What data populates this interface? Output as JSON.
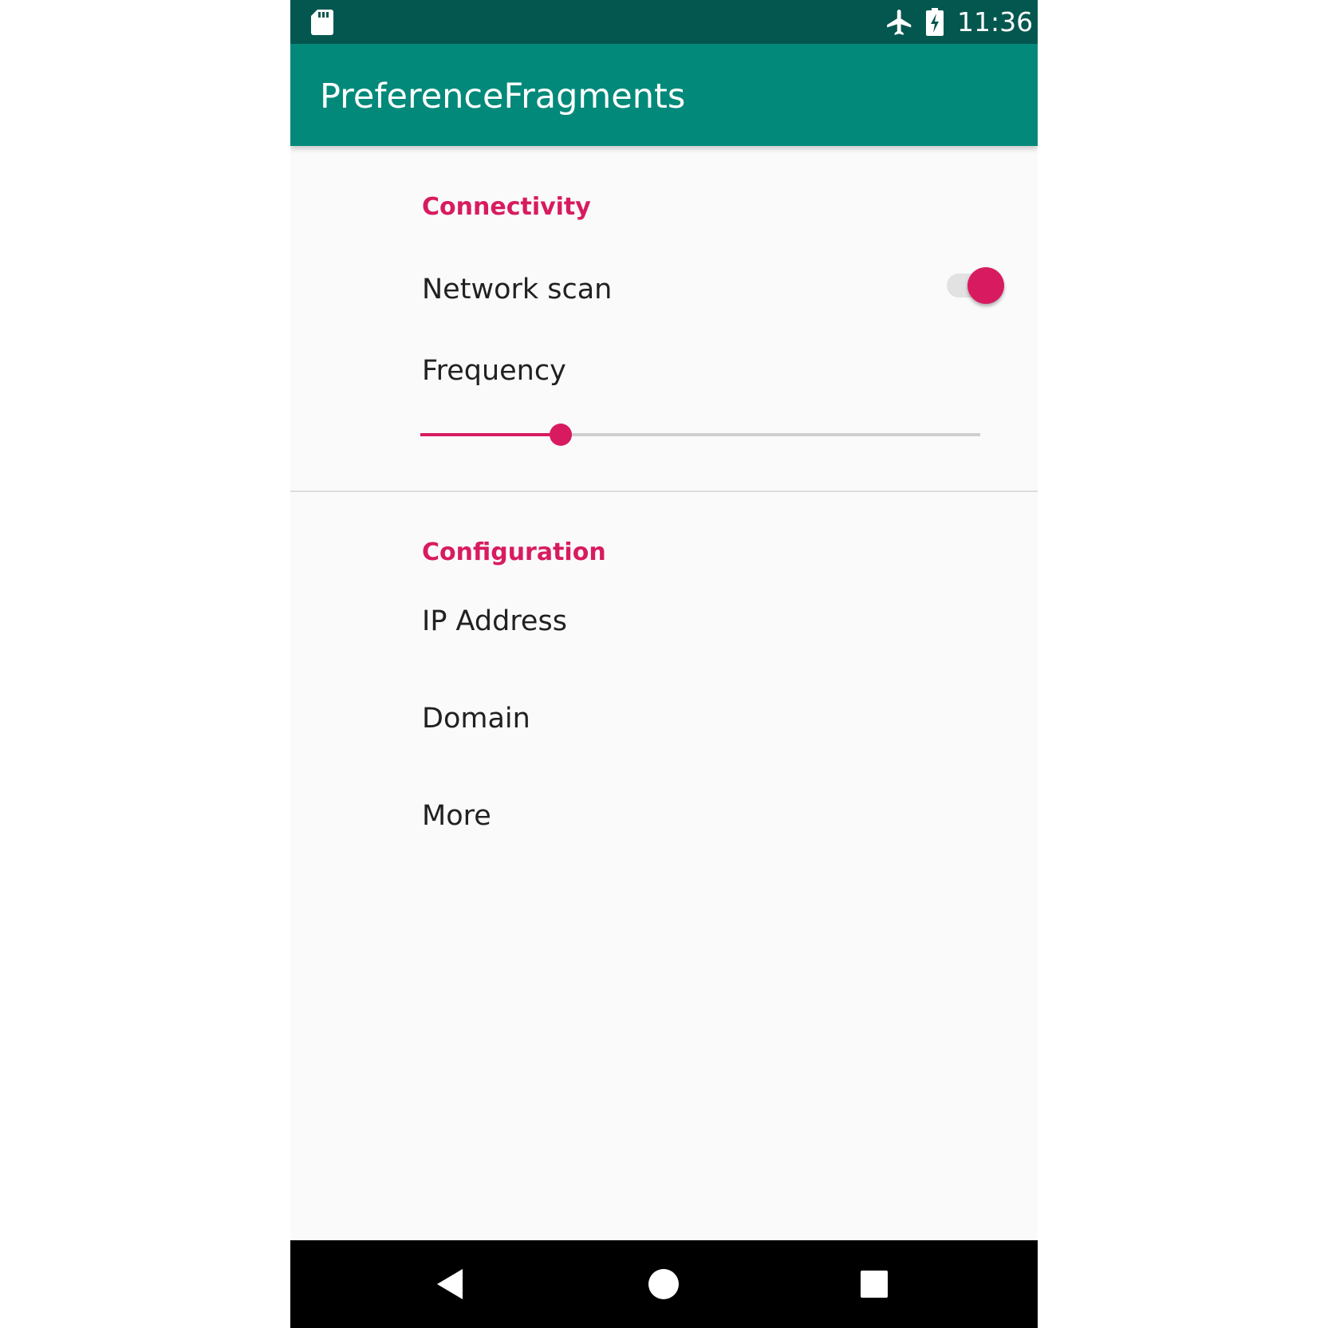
{
  "status_bar": {
    "time": "11:36",
    "icons": [
      "sd-card-icon",
      "airplane-icon",
      "battery-charging-icon"
    ]
  },
  "app_bar": {
    "title": "PreferenceFragments"
  },
  "preferences": {
    "connectivity": {
      "category_title": "Connectivity",
      "network_scan": {
        "title": "Network scan",
        "enabled": true
      },
      "frequency": {
        "title": "Frequency",
        "slider_fraction": 0.25
      }
    },
    "configuration": {
      "category_title": "Configuration",
      "items": [
        {
          "title": "IP Address"
        },
        {
          "title": "Domain"
        },
        {
          "title": "More"
        }
      ]
    }
  },
  "nav_bar": {
    "buttons": [
      "back-icon",
      "home-icon",
      "recents-icon"
    ]
  },
  "colors": {
    "status_bar": "#04574f",
    "app_bar": "#03897a",
    "accent": "#d81b60",
    "background": "#fafafa",
    "text_primary": "#212121"
  }
}
